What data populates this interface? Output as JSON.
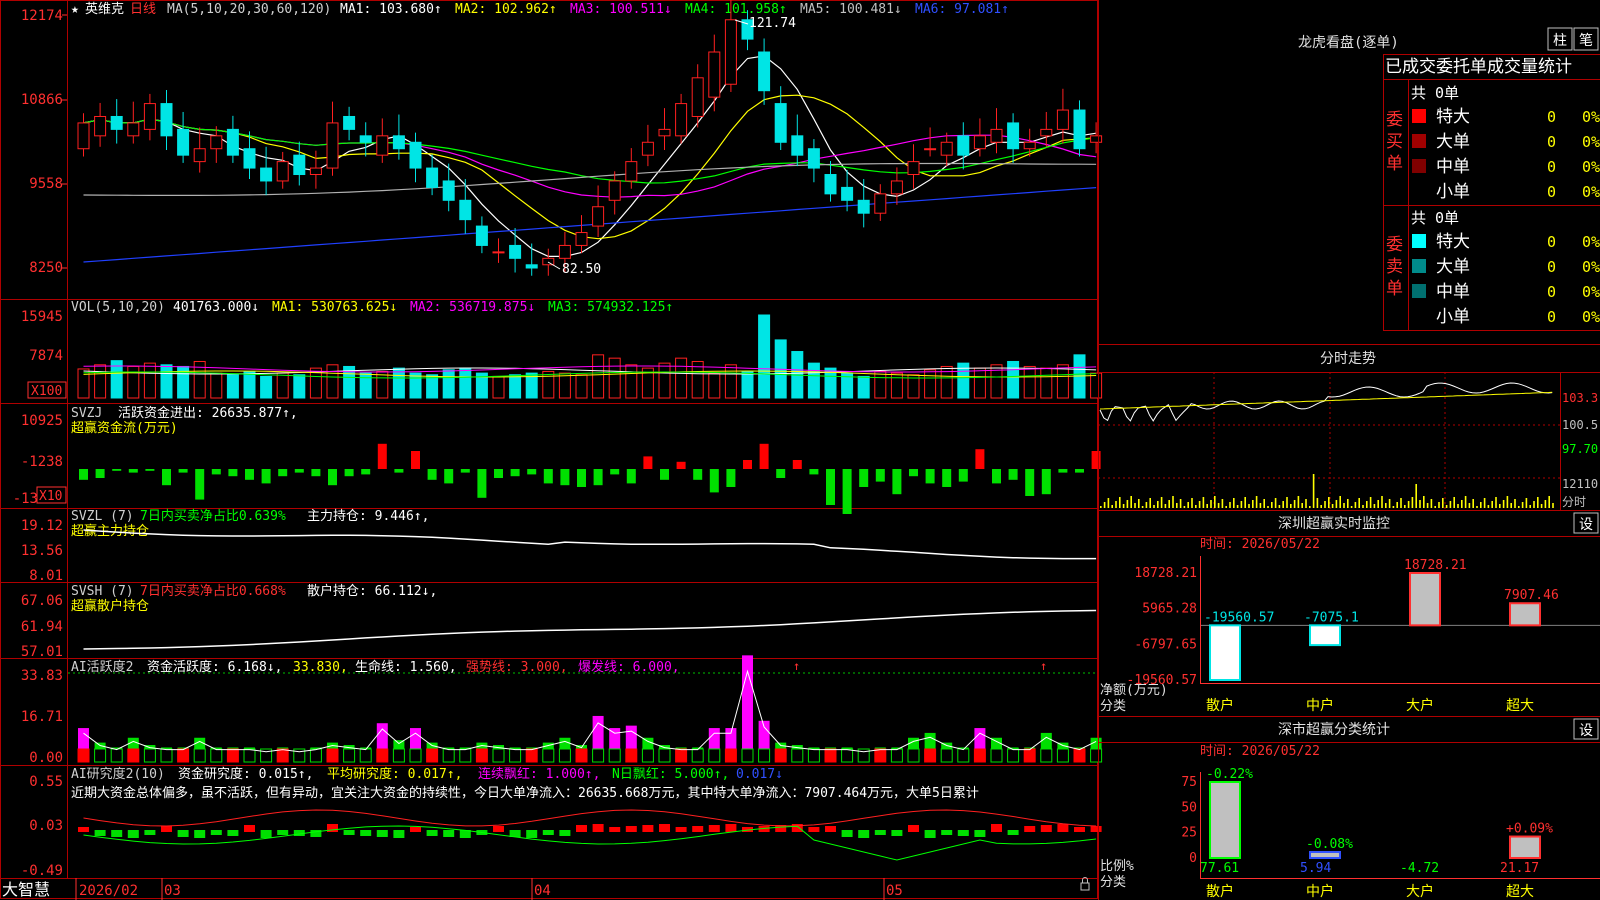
{
  "app": {
    "stock": "英维克",
    "period": "日线",
    "bottom_label": "大智慧"
  },
  "main_chart": {
    "ma_header": [
      "MA(5,10,20,30,60,120)",
      "MA1: 103.680↑",
      "MA2: 102.962↑",
      "MA3: 100.511↓",
      "MA4: 101.958↑",
      "MA5: 100.481↓",
      "MA6: 97.081↑"
    ],
    "y_ticks": [
      "12174",
      "10866",
      "9558",
      "8250"
    ],
    "high_label": "121.74",
    "low_label": "82.50"
  },
  "volume": {
    "header": [
      "VOL(5,10,20)",
      "401763.000↓",
      "MA1: 530763.625↓",
      "MA2: 536719.875↓",
      "MA3: 574932.125↑"
    ],
    "y_ticks": [
      "15945",
      "7874"
    ],
    "unit": "X100"
  },
  "svzj": {
    "header": [
      "SVZJ",
      "活跃资金进出: 26635.877↑,"
    ],
    "subtitle": "超赢资金流(万元)",
    "y_ticks": [
      "10925",
      "-1238",
      "-13"
    ],
    "unit": "X10"
  },
  "svzl": {
    "header": [
      "SVZL (7)",
      "7日内买卖净占比0.639%",
      "主力持仓: 9.446↑,"
    ],
    "subtitle": "超赢主力持仓",
    "y_ticks": [
      "19.12",
      "13.56",
      "8.01"
    ]
  },
  "svsh": {
    "header": [
      "SVSH (7)",
      "7日内买卖净占比0.668%",
      "散户持仓: 66.112↓,"
    ],
    "subtitle": "超赢散户持仓",
    "y_ticks": [
      "67.06",
      "61.94",
      "57.01"
    ]
  },
  "ai1": {
    "header": [
      "AI活跃度2",
      "资金活跃度: 6.168↓,",
      "33.830,",
      "生命线: 1.560,",
      "强势线: 3.000,",
      "爆发线: 6.000,"
    ],
    "y_ticks": [
      "33.83",
      "16.71",
      "0.00"
    ]
  },
  "ai2": {
    "header": [
      "AI研究度2(10)",
      "资金研究度: 0.015↑,",
      "平均研究度: 0.017↑,",
      "连续飘红: 1.000↑,",
      "N日飘红: 5.000↑,",
      "0.017↓"
    ],
    "comment": "近期大资金总体偏多，虽不活跃，但有异动，宜关注大资金的持续性，今日大单净流入：26635.668万元，其中特大单净流入：7907.464万元，大单5日累计",
    "y_ticks": [
      "0.55",
      "0.03",
      "-0.49"
    ]
  },
  "x_axis": {
    "labels": [
      "2026/02",
      "03",
      "04",
      "05"
    ]
  },
  "right_panel": {
    "lhb": {
      "title": "龙虎看盘(逐单)",
      "btn1": "柱",
      "btn2": "笔",
      "subtitle": "已成交委托单成交量统计",
      "buy_label": "委买单",
      "sell_label": "委卖单",
      "buy_total": "共 0单",
      "sell_total": "共 0单",
      "rows": [
        {
          "name": "特大",
          "val": "0",
          "pct": "0%"
        },
        {
          "name": "大单",
          "val": "0",
          "pct": "0%"
        },
        {
          "name": "中单",
          "val": "0",
          "pct": "0%"
        },
        {
          "name": "小单",
          "val": "0",
          "pct": "0%"
        }
      ]
    },
    "intraday": {
      "title": "分时走势",
      "y_labels": [
        "103.3",
        "100.5",
        "97.70",
        "12110",
        "分时"
      ]
    },
    "monitor": {
      "title": "深圳超赢实时监控",
      "btn": "设",
      "date": "时间: 2026/05/22",
      "y_ticks": [
        "18728.21",
        "5965.28",
        "-6797.65",
        "-19560.57"
      ],
      "axis_name_1": "净额(万元)",
      "axis_name_2": "分类"
    },
    "classify": {
      "title": "深市超赢分类统计",
      "btn": "设",
      "date": "时间: 2026/05/22",
      "y_ticks": [
        "75",
        "50",
        "25",
        "0"
      ],
      "axis_name_1": "比例%",
      "axis_name_2": "分类"
    }
  },
  "colors": {
    "up": "#ff2020",
    "down": "#00e5e5",
    "border": "#b00000",
    "ma1": "#ffffff",
    "ma2": "#ffff00",
    "ma3": "#ff00ff",
    "ma4": "#00ff00",
    "ma5": "#b0b0b0",
    "ma6": "#2040ff"
  },
  "chart_data": [
    {
      "type": "bar",
      "title": "深圳超赢实时监控",
      "ylabel": "净额(万元)",
      "categories": [
        "散户",
        "中户",
        "大户",
        "超大"
      ],
      "values": [
        -19560.57,
        -7075.1,
        18728.21,
        7907.46
      ],
      "ylim": [
        -19560.57,
        18728.21
      ]
    },
    {
      "type": "bar",
      "title": "深市超赢分类统计",
      "ylabel": "比例%",
      "categories": [
        "散户",
        "中户",
        "大户",
        "超大"
      ],
      "values": [
        77.61,
        5.94,
        -4.72,
        21.17
      ],
      "changes": [
        "-0.22%",
        "-0.08%",
        "",
        "+0.09%"
      ],
      "ylim": [
        0,
        75
      ]
    }
  ]
}
